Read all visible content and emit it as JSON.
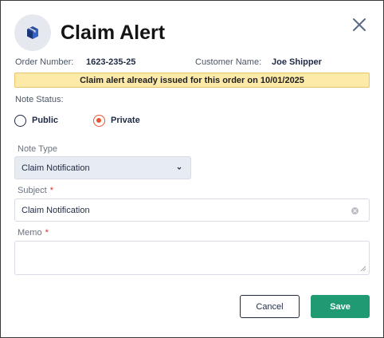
{
  "dialog": {
    "title": "Claim Alert",
    "header_icon": "package-icon",
    "close_icon": "close-icon"
  },
  "order": {
    "number_label": "Order Number:",
    "number_value": "1623-235-25",
    "customer_label": "Customer Name:",
    "customer_value": "Joe Shipper"
  },
  "alert": {
    "message": "Claim alert already issued for this order on 10/01/2025"
  },
  "note_status": {
    "label": "Note Status:",
    "options": [
      {
        "label": "Public",
        "checked": false
      },
      {
        "label": "Private",
        "checked": true
      }
    ]
  },
  "note_type": {
    "label": "Note Type",
    "value": "Claim Notification"
  },
  "subject": {
    "label": "Subject",
    "required_mark": "*",
    "value": "Claim Notification"
  },
  "memo": {
    "label": "Memo",
    "required_mark": "*",
    "value": ""
  },
  "actions": {
    "cancel_label": "Cancel",
    "save_label": "Save"
  },
  "colors": {
    "accent_radio": "#e8542f",
    "save_button": "#1f9a73",
    "alert_background": "#fde9a8",
    "brand_navy": "#1f2a44"
  }
}
